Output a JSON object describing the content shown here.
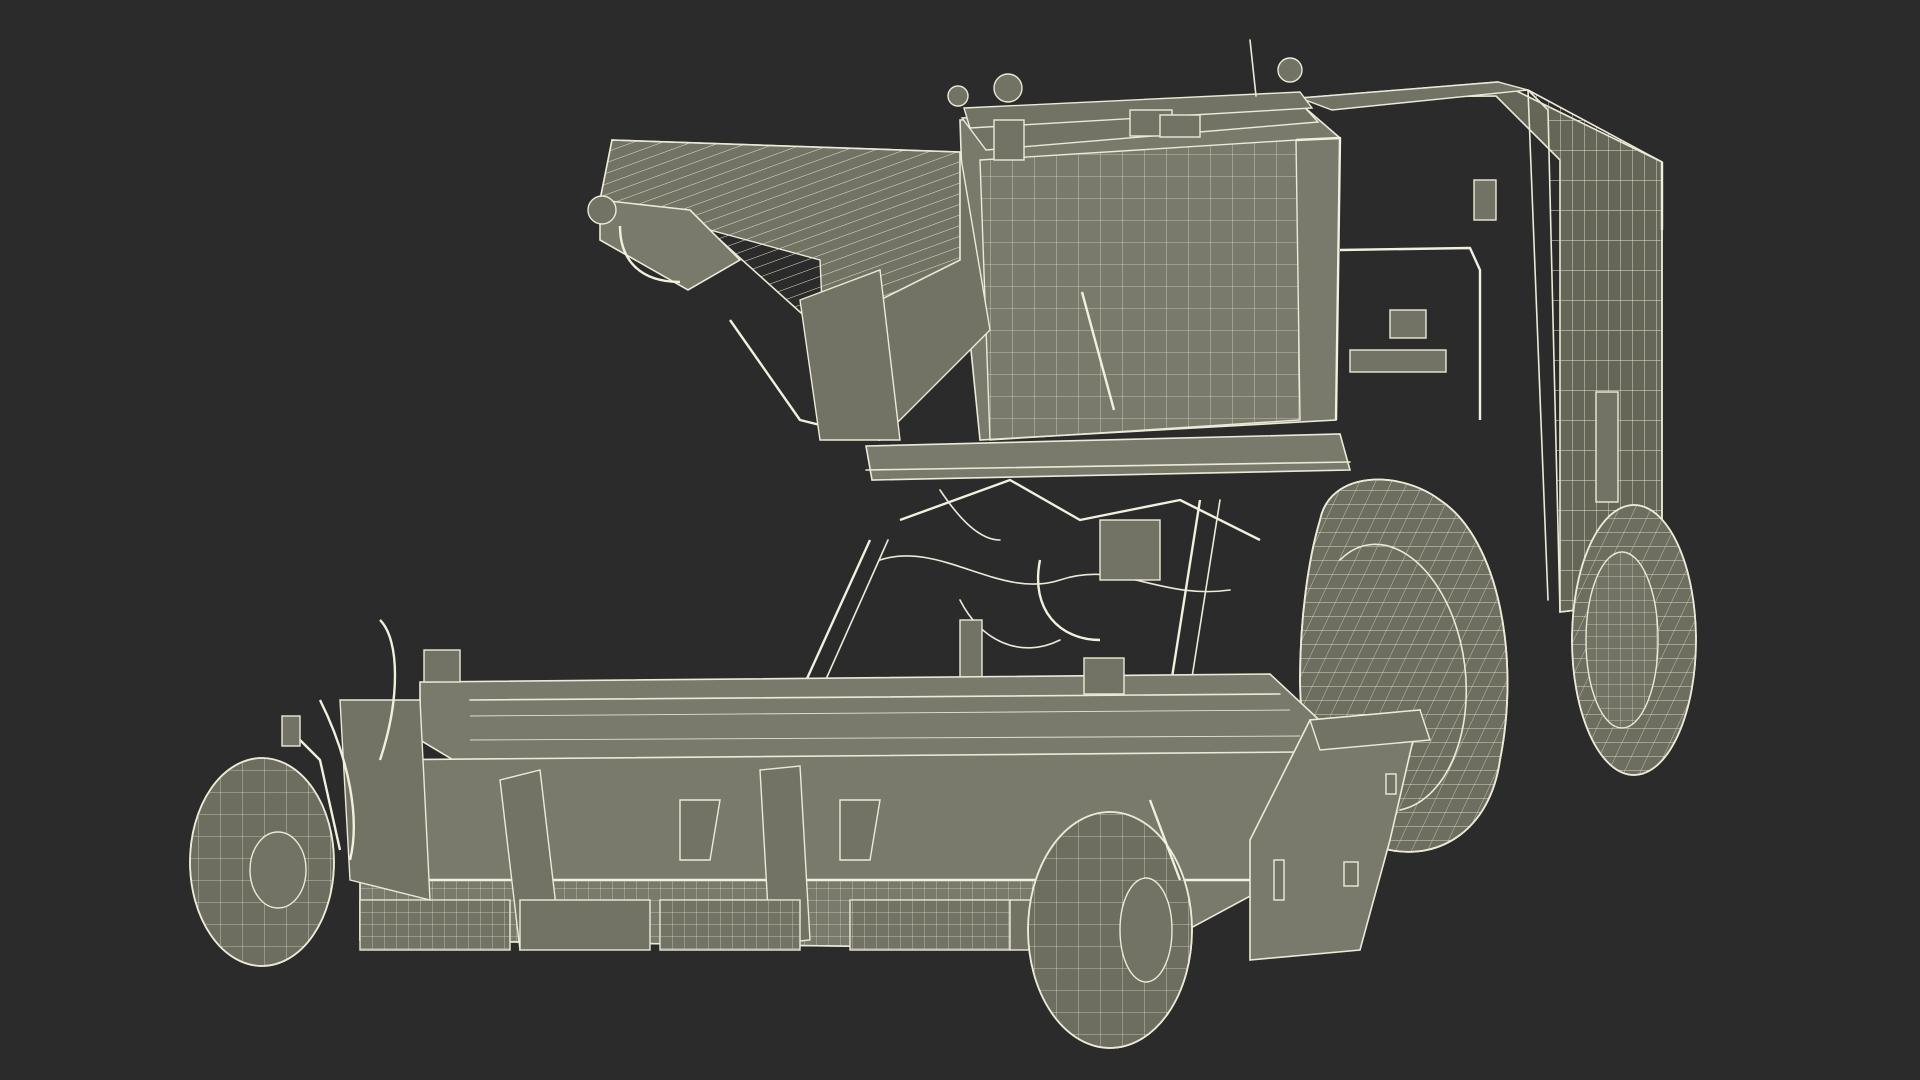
{
  "scene": {
    "subject": "wireframe-harvester",
    "colors": {
      "background": "#2b2b2b",
      "wire": "#ece9d6",
      "fill": "#7a7a6c"
    }
  }
}
